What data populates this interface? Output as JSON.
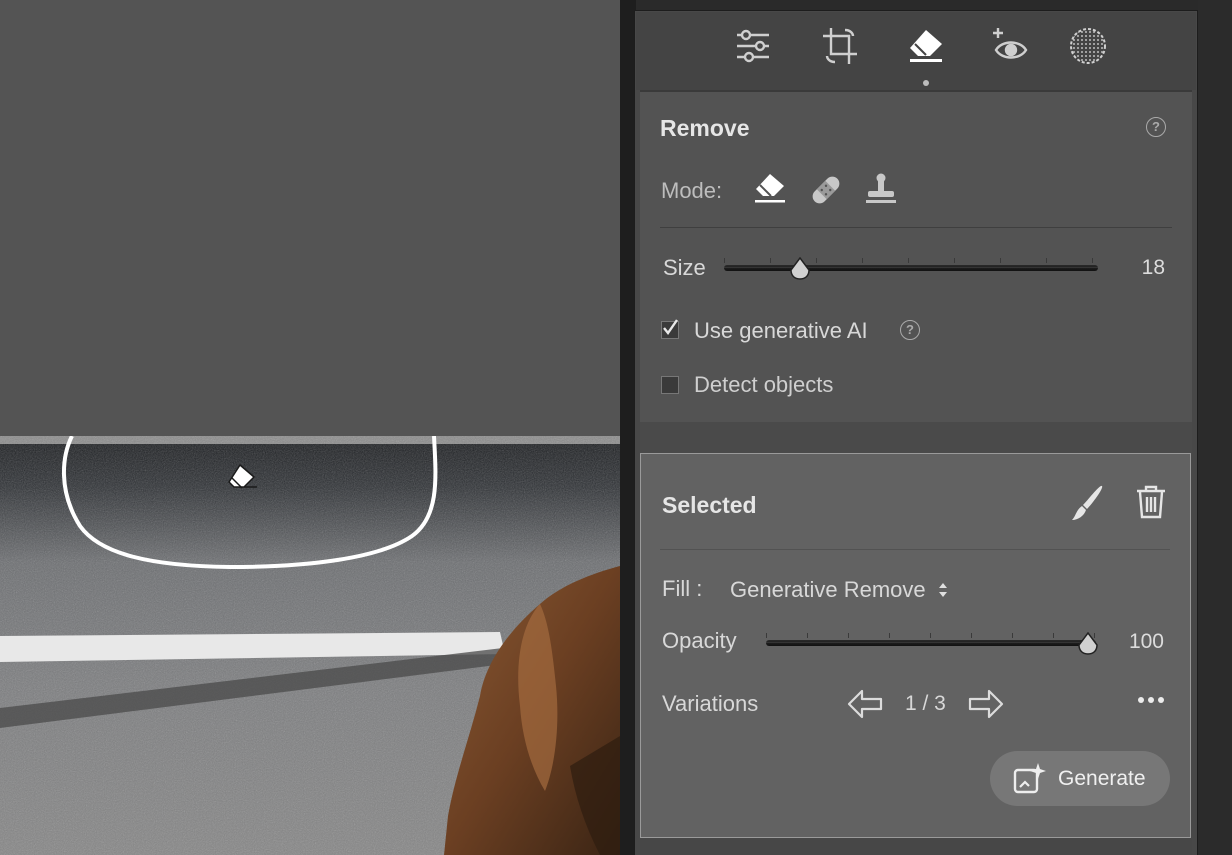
{
  "toolbar": {
    "tools": [
      "edit-sliders-icon",
      "crop-icon",
      "remove-eraser-icon",
      "red-eye-icon",
      "masking-icon"
    ],
    "active_tool": "remove-eraser-icon"
  },
  "remove_panel": {
    "title": "Remove",
    "mode_label": "Mode:",
    "modes": [
      "remove-mode-eraser-icon",
      "heal-mode-bandage-icon",
      "clone-mode-stamp-icon"
    ],
    "size_label": "Size",
    "size_value": "18",
    "size_fraction": 0.19,
    "use_ai_label": "Use generative AI",
    "use_ai_checked": true,
    "detect_label": "Detect objects",
    "detect_checked": false
  },
  "selected_panel": {
    "title": "Selected",
    "fill_label": "Fill :",
    "fill_value": "Generative Remove",
    "opacity_label": "Opacity",
    "opacity_value": "100",
    "opacity_fraction": 1.0,
    "variations_label": "Variations",
    "variations_counter": "1 / 3",
    "generate_label": "Generate"
  },
  "colors": {
    "canvas_bg": "#545454",
    "panel_bg": "#535353",
    "selected_bg": "#626262",
    "accent_white": "#ffffff"
  }
}
